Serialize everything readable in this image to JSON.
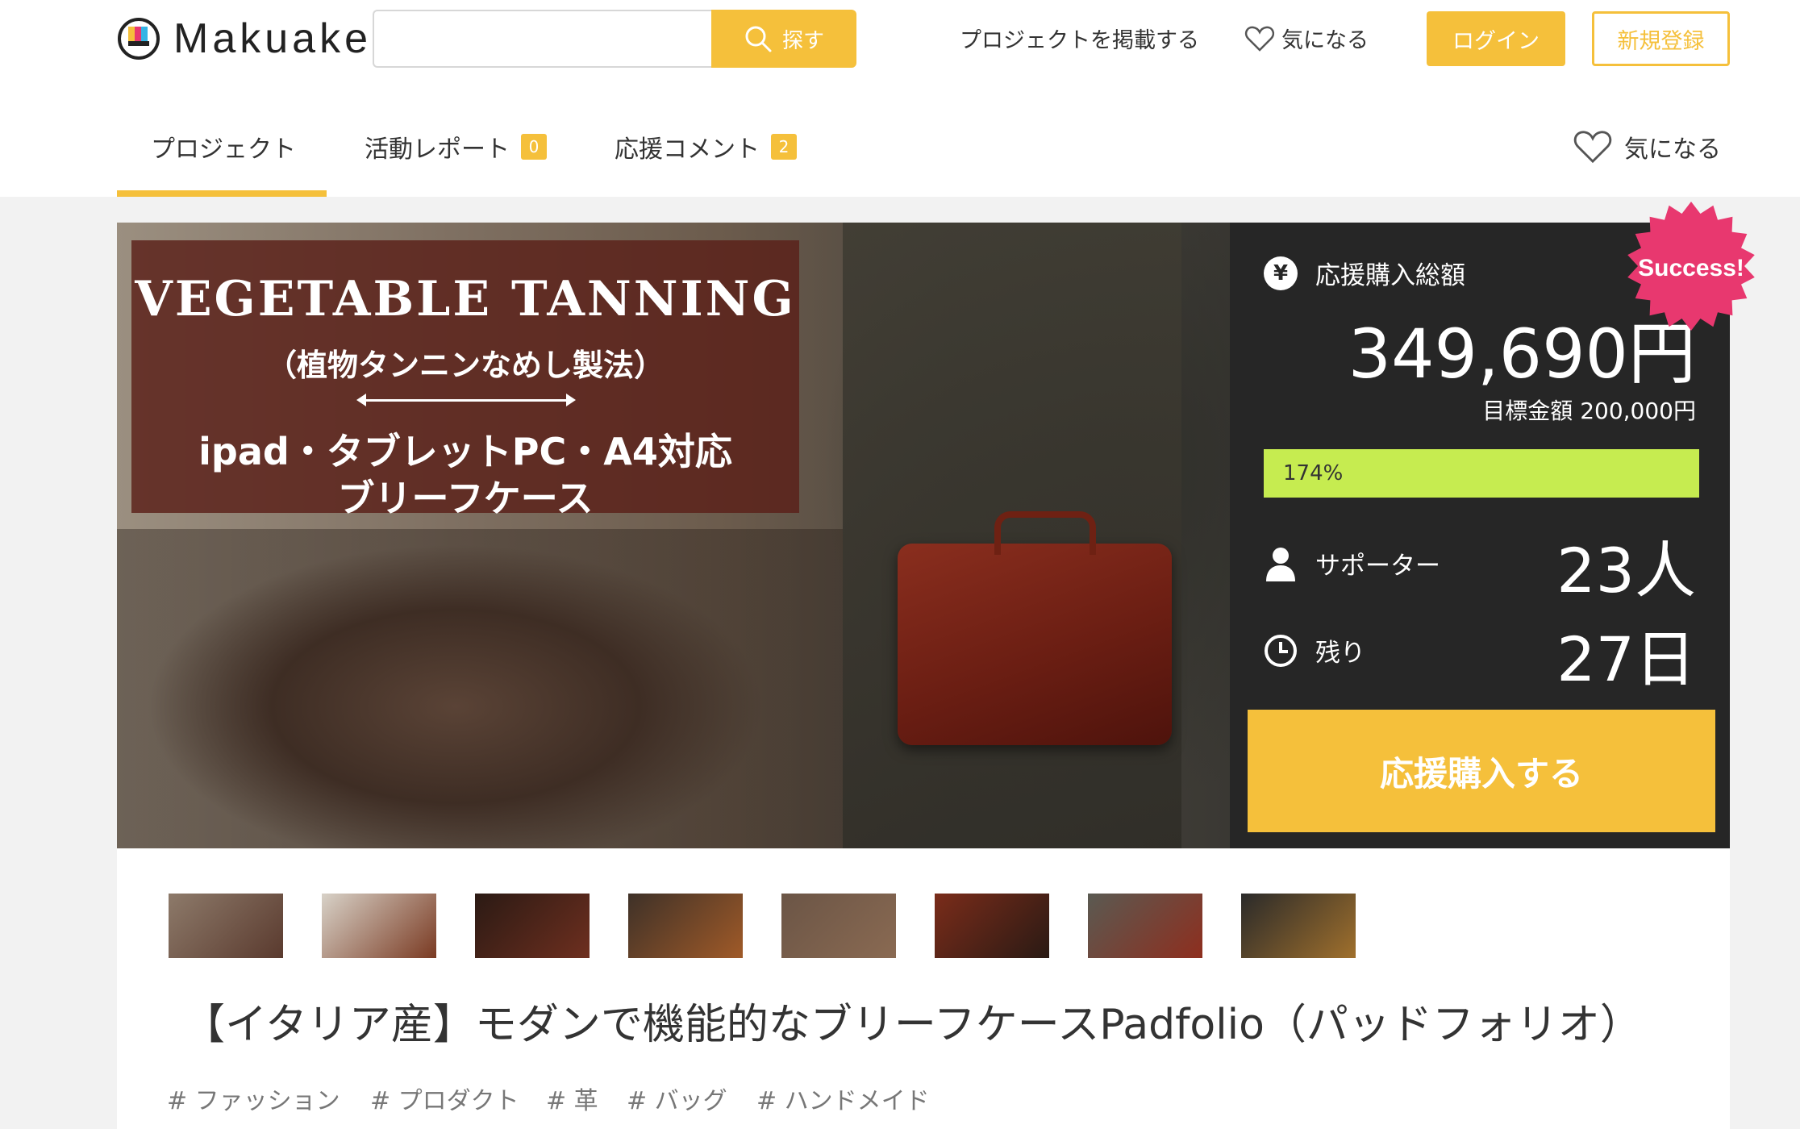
{
  "logo": {
    "text": "Makuake"
  },
  "search": {
    "placeholder": "",
    "button_label": "探す"
  },
  "header_nav": {
    "post_project": "プロジェクトを掲載する",
    "favorite": "気になる",
    "login": "ログイン",
    "signup": "新規登録"
  },
  "tabs": [
    {
      "label": "プロジェクト",
      "badge": null
    },
    {
      "label": "活動レポート",
      "badge": "0"
    },
    {
      "label": "応援コメント",
      "badge": "2"
    }
  ],
  "tab_favorite": "気になる",
  "hero": {
    "title": "VEGETABLE TANNING",
    "subtitle": "（植物タンニンなめし製法）",
    "line3": "ipad・タブレットPC・A4対応",
    "line4": "ブリーフケース"
  },
  "panel": {
    "total_label": "応援購入総額",
    "total_value": "349,690円",
    "goal_text": "目標金額 200,000円",
    "progress_text": "174%",
    "progress_fraction": 1.0,
    "supporters_label": "サポーター",
    "supporters_value": "23人",
    "remaining_label": "残り",
    "remaining_value": "27日",
    "cta_label": "応援購入する",
    "success_badge": "Success!"
  },
  "thumbnails": [
    "thumb-1",
    "thumb-2",
    "thumb-3",
    "thumb-4",
    "thumb-5",
    "thumb-6",
    "thumb-7",
    "thumb-8"
  ],
  "project_title": "【イタリア産】モダンで機能的なブリーフケースPadfolio（パッドフォリオ）",
  "tags": [
    "# ファッション",
    "# プロダクト",
    "# 革",
    "# バッグ",
    "# ハンドメイド"
  ],
  "colors": {
    "accent": "#f5c03b",
    "panel_bg": "#262626",
    "progress": "#c6ec50",
    "success_badge": "#e8386f"
  }
}
